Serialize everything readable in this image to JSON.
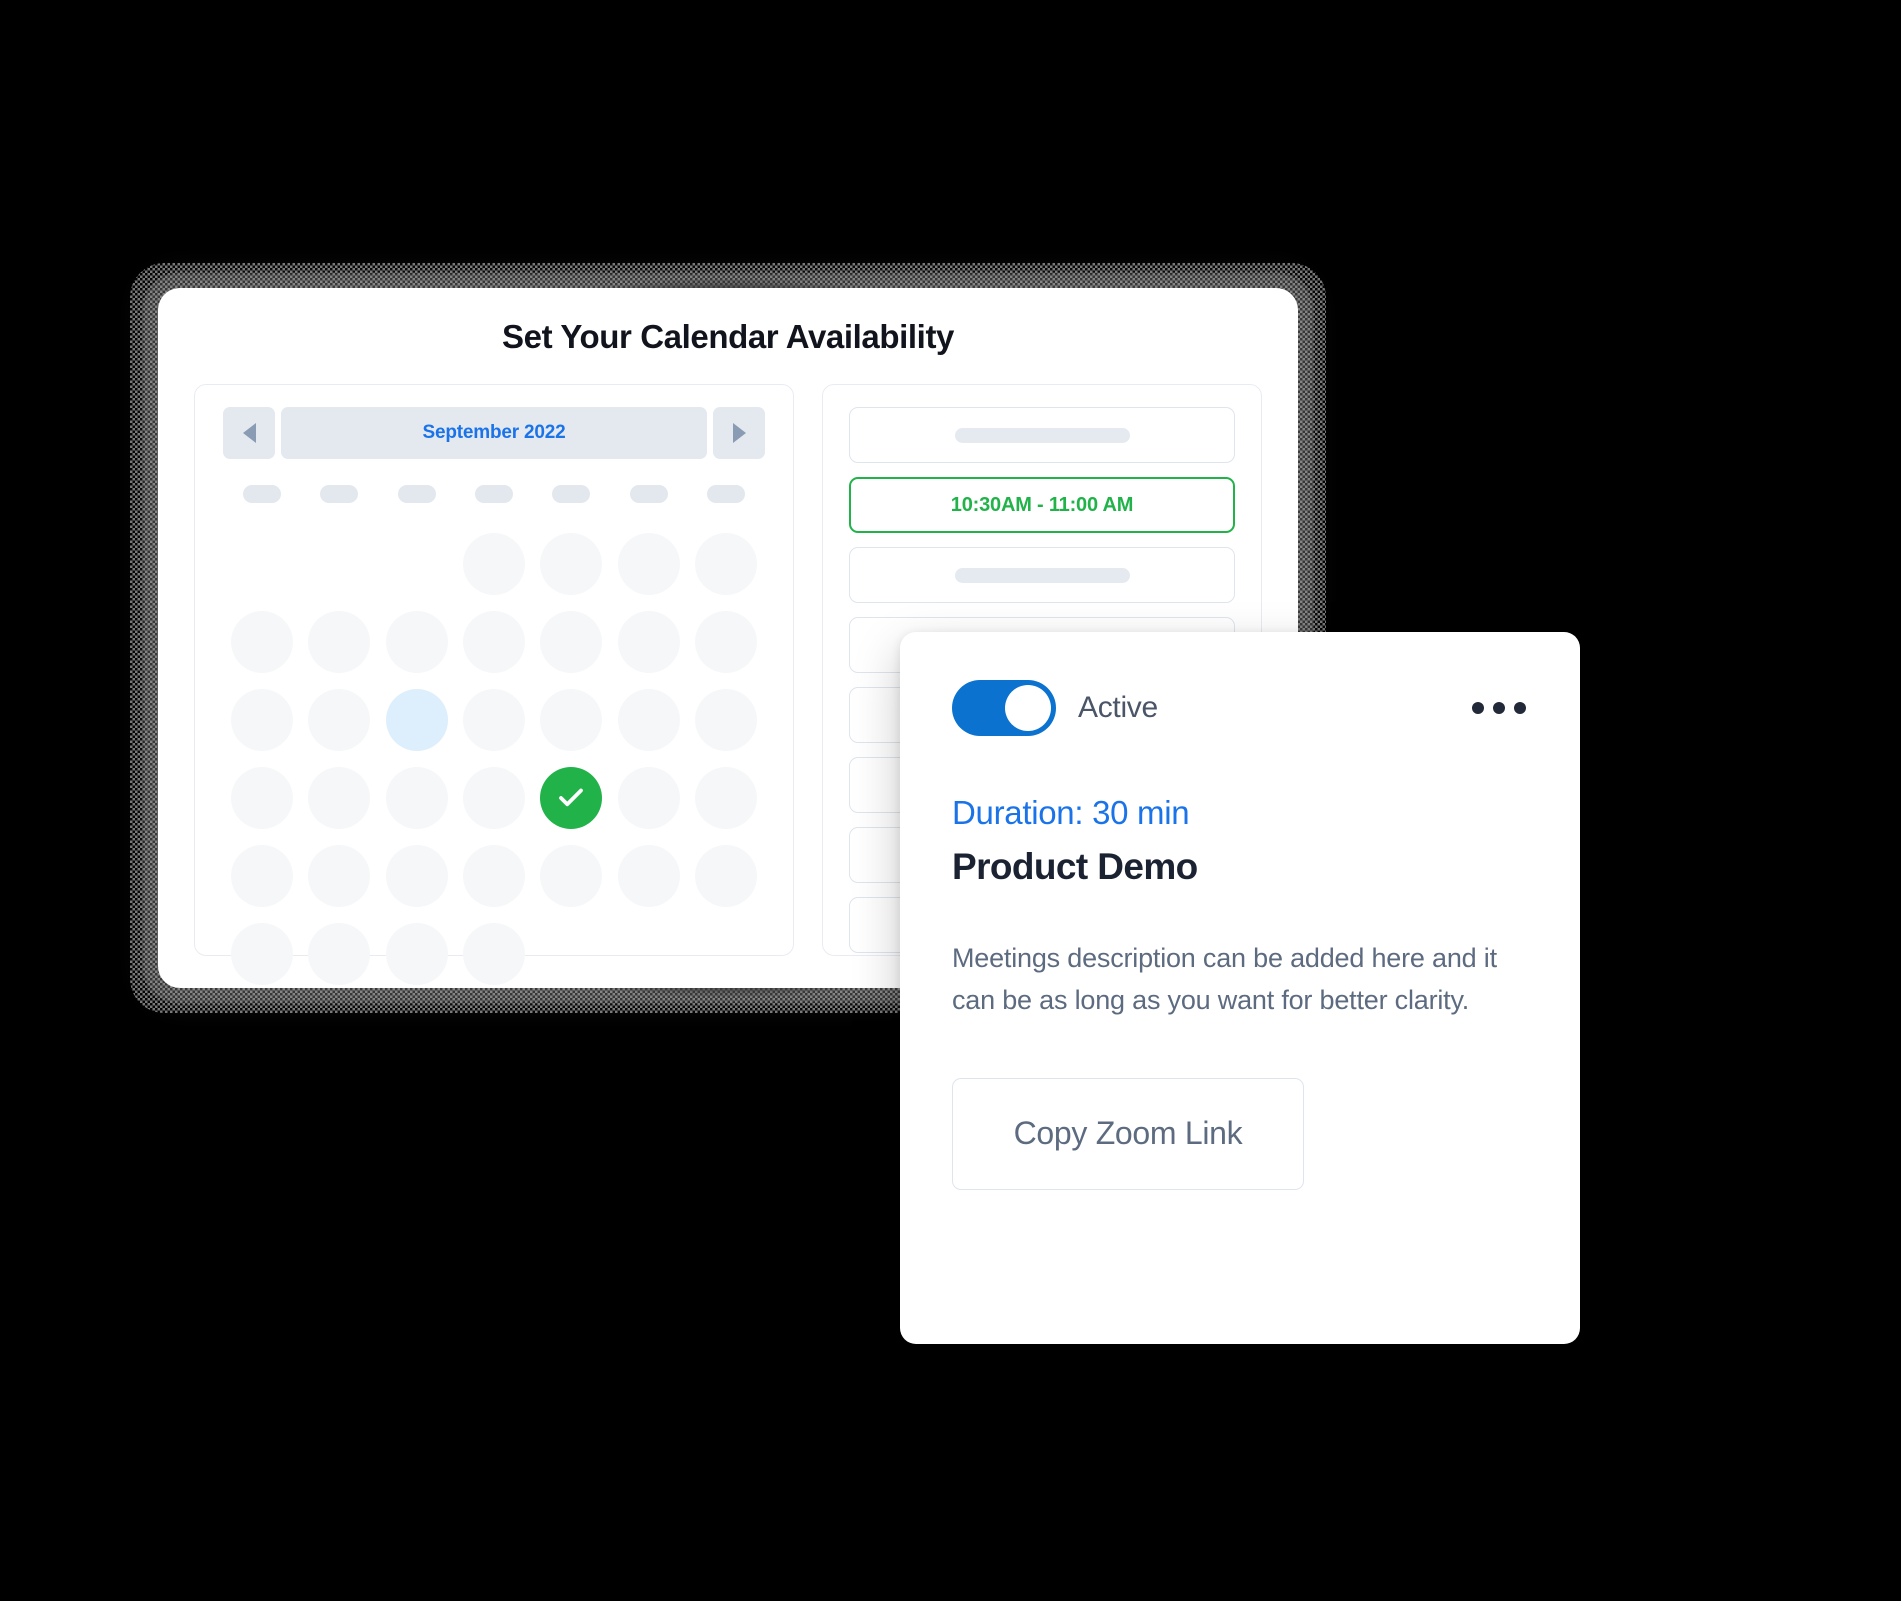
{
  "page": {
    "title": "Set Your Calendar Availability",
    "background_color": "#000000"
  },
  "calendar": {
    "prev_label": "◀",
    "next_label": "▶",
    "month_label": "September 2022",
    "weekday_placeholder_count": 7,
    "grid": {
      "rows": 6,
      "columns": 7,
      "row_cells": [
        [
          "empty",
          "empty",
          "empty",
          "day",
          "day",
          "day",
          "day"
        ],
        [
          "day",
          "day",
          "day",
          "day",
          "day",
          "day",
          "day"
        ],
        [
          "day",
          "day",
          "highlight",
          "day",
          "day",
          "day",
          "day"
        ],
        [
          "day",
          "day",
          "day",
          "day",
          "selected",
          "day",
          "day"
        ],
        [
          "day",
          "day",
          "day",
          "day",
          "day",
          "day",
          "day"
        ],
        [
          "day",
          "day",
          "day",
          "day",
          "empty",
          "empty",
          "empty"
        ]
      ],
      "selected_icon": "check-icon",
      "selected_color": "#21b34a",
      "highlight_color": "#ddeefc",
      "day_color": "#f5f7f9"
    }
  },
  "time_slots": [
    {
      "type": "placeholder",
      "label": ""
    },
    {
      "type": "active",
      "label": "10:30AM - 11:00 AM"
    },
    {
      "type": "placeholder",
      "label": ""
    },
    {
      "type": "placeholder",
      "label": ""
    },
    {
      "type": "placeholder",
      "label": ""
    },
    {
      "type": "placeholder",
      "label": ""
    },
    {
      "type": "placeholder",
      "label": ""
    },
    {
      "type": "placeholder",
      "label": ""
    }
  ],
  "detail_card": {
    "toggle_state": "on",
    "toggle_label": "Active",
    "toggle_color": "#0b72d0",
    "menu_icon": "kebab-menu-icon",
    "duration": "Duration: 30 min",
    "duration_color": "#1a73e8",
    "meeting_title": "Product Demo",
    "description": "Meetings description can be added here and it can be as long as you want for better clarity.",
    "copy_button_label": "Copy Zoom Link"
  }
}
